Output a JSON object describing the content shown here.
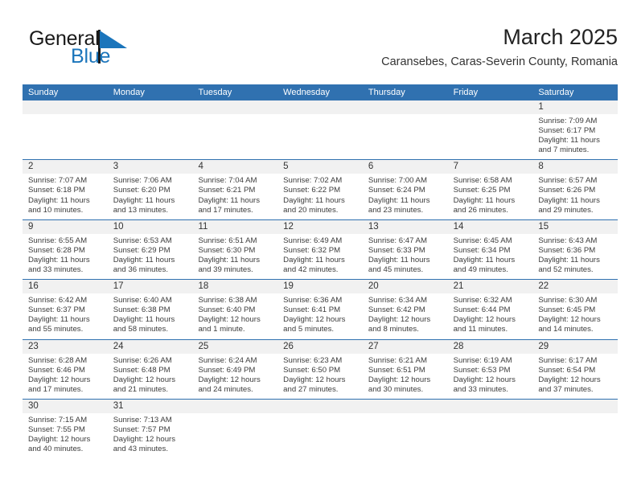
{
  "brand": {
    "name_part1": "General",
    "name_part2": "Blue",
    "color_dark": "#1a1a1a",
    "color_blue": "#1b75bb"
  },
  "header": {
    "month_title": "March 2025",
    "location": "Caransebes, Caras-Severin County, Romania",
    "header_bg": "#3071b0"
  },
  "weekdays": [
    "Sunday",
    "Monday",
    "Tuesday",
    "Wednesday",
    "Thursday",
    "Friday",
    "Saturday"
  ],
  "weeks": [
    [
      {
        "day": "",
        "sunrise": "",
        "sunset": "",
        "daylight1": "",
        "daylight2": ""
      },
      {
        "day": "",
        "sunrise": "",
        "sunset": "",
        "daylight1": "",
        "daylight2": ""
      },
      {
        "day": "",
        "sunrise": "",
        "sunset": "",
        "daylight1": "",
        "daylight2": ""
      },
      {
        "day": "",
        "sunrise": "",
        "sunset": "",
        "daylight1": "",
        "daylight2": ""
      },
      {
        "day": "",
        "sunrise": "",
        "sunset": "",
        "daylight1": "",
        "daylight2": ""
      },
      {
        "day": "",
        "sunrise": "",
        "sunset": "",
        "daylight1": "",
        "daylight2": ""
      },
      {
        "day": "1",
        "sunrise": "Sunrise: 7:09 AM",
        "sunset": "Sunset: 6:17 PM",
        "daylight1": "Daylight: 11 hours",
        "daylight2": "and 7 minutes."
      }
    ],
    [
      {
        "day": "2",
        "sunrise": "Sunrise: 7:07 AM",
        "sunset": "Sunset: 6:18 PM",
        "daylight1": "Daylight: 11 hours",
        "daylight2": "and 10 minutes."
      },
      {
        "day": "3",
        "sunrise": "Sunrise: 7:06 AM",
        "sunset": "Sunset: 6:20 PM",
        "daylight1": "Daylight: 11 hours",
        "daylight2": "and 13 minutes."
      },
      {
        "day": "4",
        "sunrise": "Sunrise: 7:04 AM",
        "sunset": "Sunset: 6:21 PM",
        "daylight1": "Daylight: 11 hours",
        "daylight2": "and 17 minutes."
      },
      {
        "day": "5",
        "sunrise": "Sunrise: 7:02 AM",
        "sunset": "Sunset: 6:22 PM",
        "daylight1": "Daylight: 11 hours",
        "daylight2": "and 20 minutes."
      },
      {
        "day": "6",
        "sunrise": "Sunrise: 7:00 AM",
        "sunset": "Sunset: 6:24 PM",
        "daylight1": "Daylight: 11 hours",
        "daylight2": "and 23 minutes."
      },
      {
        "day": "7",
        "sunrise": "Sunrise: 6:58 AM",
        "sunset": "Sunset: 6:25 PM",
        "daylight1": "Daylight: 11 hours",
        "daylight2": "and 26 minutes."
      },
      {
        "day": "8",
        "sunrise": "Sunrise: 6:57 AM",
        "sunset": "Sunset: 6:26 PM",
        "daylight1": "Daylight: 11 hours",
        "daylight2": "and 29 minutes."
      }
    ],
    [
      {
        "day": "9",
        "sunrise": "Sunrise: 6:55 AM",
        "sunset": "Sunset: 6:28 PM",
        "daylight1": "Daylight: 11 hours",
        "daylight2": "and 33 minutes."
      },
      {
        "day": "10",
        "sunrise": "Sunrise: 6:53 AM",
        "sunset": "Sunset: 6:29 PM",
        "daylight1": "Daylight: 11 hours",
        "daylight2": "and 36 minutes."
      },
      {
        "day": "11",
        "sunrise": "Sunrise: 6:51 AM",
        "sunset": "Sunset: 6:30 PM",
        "daylight1": "Daylight: 11 hours",
        "daylight2": "and 39 minutes."
      },
      {
        "day": "12",
        "sunrise": "Sunrise: 6:49 AM",
        "sunset": "Sunset: 6:32 PM",
        "daylight1": "Daylight: 11 hours",
        "daylight2": "and 42 minutes."
      },
      {
        "day": "13",
        "sunrise": "Sunrise: 6:47 AM",
        "sunset": "Sunset: 6:33 PM",
        "daylight1": "Daylight: 11 hours",
        "daylight2": "and 45 minutes."
      },
      {
        "day": "14",
        "sunrise": "Sunrise: 6:45 AM",
        "sunset": "Sunset: 6:34 PM",
        "daylight1": "Daylight: 11 hours",
        "daylight2": "and 49 minutes."
      },
      {
        "day": "15",
        "sunrise": "Sunrise: 6:43 AM",
        "sunset": "Sunset: 6:36 PM",
        "daylight1": "Daylight: 11 hours",
        "daylight2": "and 52 minutes."
      }
    ],
    [
      {
        "day": "16",
        "sunrise": "Sunrise: 6:42 AM",
        "sunset": "Sunset: 6:37 PM",
        "daylight1": "Daylight: 11 hours",
        "daylight2": "and 55 minutes."
      },
      {
        "day": "17",
        "sunrise": "Sunrise: 6:40 AM",
        "sunset": "Sunset: 6:38 PM",
        "daylight1": "Daylight: 11 hours",
        "daylight2": "and 58 minutes."
      },
      {
        "day": "18",
        "sunrise": "Sunrise: 6:38 AM",
        "sunset": "Sunset: 6:40 PM",
        "daylight1": "Daylight: 12 hours",
        "daylight2": "and 1 minute."
      },
      {
        "day": "19",
        "sunrise": "Sunrise: 6:36 AM",
        "sunset": "Sunset: 6:41 PM",
        "daylight1": "Daylight: 12 hours",
        "daylight2": "and 5 minutes."
      },
      {
        "day": "20",
        "sunrise": "Sunrise: 6:34 AM",
        "sunset": "Sunset: 6:42 PM",
        "daylight1": "Daylight: 12 hours",
        "daylight2": "and 8 minutes."
      },
      {
        "day": "21",
        "sunrise": "Sunrise: 6:32 AM",
        "sunset": "Sunset: 6:44 PM",
        "daylight1": "Daylight: 12 hours",
        "daylight2": "and 11 minutes."
      },
      {
        "day": "22",
        "sunrise": "Sunrise: 6:30 AM",
        "sunset": "Sunset: 6:45 PM",
        "daylight1": "Daylight: 12 hours",
        "daylight2": "and 14 minutes."
      }
    ],
    [
      {
        "day": "23",
        "sunrise": "Sunrise: 6:28 AM",
        "sunset": "Sunset: 6:46 PM",
        "daylight1": "Daylight: 12 hours",
        "daylight2": "and 17 minutes."
      },
      {
        "day": "24",
        "sunrise": "Sunrise: 6:26 AM",
        "sunset": "Sunset: 6:48 PM",
        "daylight1": "Daylight: 12 hours",
        "daylight2": "and 21 minutes."
      },
      {
        "day": "25",
        "sunrise": "Sunrise: 6:24 AM",
        "sunset": "Sunset: 6:49 PM",
        "daylight1": "Daylight: 12 hours",
        "daylight2": "and 24 minutes."
      },
      {
        "day": "26",
        "sunrise": "Sunrise: 6:23 AM",
        "sunset": "Sunset: 6:50 PM",
        "daylight1": "Daylight: 12 hours",
        "daylight2": "and 27 minutes."
      },
      {
        "day": "27",
        "sunrise": "Sunrise: 6:21 AM",
        "sunset": "Sunset: 6:51 PM",
        "daylight1": "Daylight: 12 hours",
        "daylight2": "and 30 minutes."
      },
      {
        "day": "28",
        "sunrise": "Sunrise: 6:19 AM",
        "sunset": "Sunset: 6:53 PM",
        "daylight1": "Daylight: 12 hours",
        "daylight2": "and 33 minutes."
      },
      {
        "day": "29",
        "sunrise": "Sunrise: 6:17 AM",
        "sunset": "Sunset: 6:54 PM",
        "daylight1": "Daylight: 12 hours",
        "daylight2": "and 37 minutes."
      }
    ],
    [
      {
        "day": "30",
        "sunrise": "Sunrise: 7:15 AM",
        "sunset": "Sunset: 7:55 PM",
        "daylight1": "Daylight: 12 hours",
        "daylight2": "and 40 minutes."
      },
      {
        "day": "31",
        "sunrise": "Sunrise: 7:13 AM",
        "sunset": "Sunset: 7:57 PM",
        "daylight1": "Daylight: 12 hours",
        "daylight2": "and 43 minutes."
      },
      {
        "day": "",
        "sunrise": "",
        "sunset": "",
        "daylight1": "",
        "daylight2": ""
      },
      {
        "day": "",
        "sunrise": "",
        "sunset": "",
        "daylight1": "",
        "daylight2": ""
      },
      {
        "day": "",
        "sunrise": "",
        "sunset": "",
        "daylight1": "",
        "daylight2": ""
      },
      {
        "day": "",
        "sunrise": "",
        "sunset": "",
        "daylight1": "",
        "daylight2": ""
      },
      {
        "day": "",
        "sunrise": "",
        "sunset": "",
        "daylight1": "",
        "daylight2": ""
      }
    ]
  ]
}
